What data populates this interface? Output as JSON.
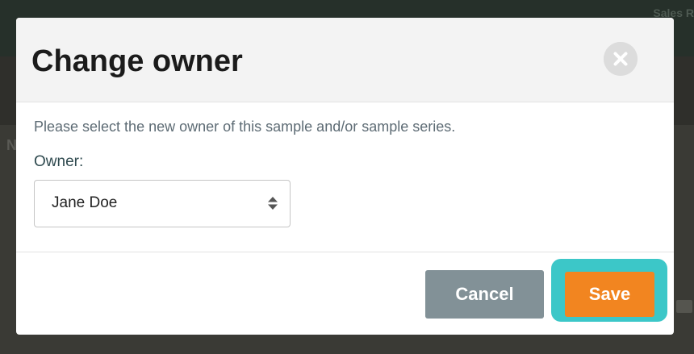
{
  "background": {
    "app_header_text": "Sales R",
    "side_letter": "N"
  },
  "dialog": {
    "title": "Change owner",
    "close_icon": "close-icon",
    "instructions": "Please select the new owner of this sample and/or sample series.",
    "owner_field": {
      "label": "Owner:",
      "selected_value": "Jane Doe",
      "caret_icon": "sort-caret-icon"
    },
    "buttons": {
      "cancel_label": "Cancel",
      "save_label": "Save"
    },
    "colors": {
      "save": "#f28520",
      "save_highlight": "#3cc7c8",
      "cancel": "#829197"
    }
  }
}
